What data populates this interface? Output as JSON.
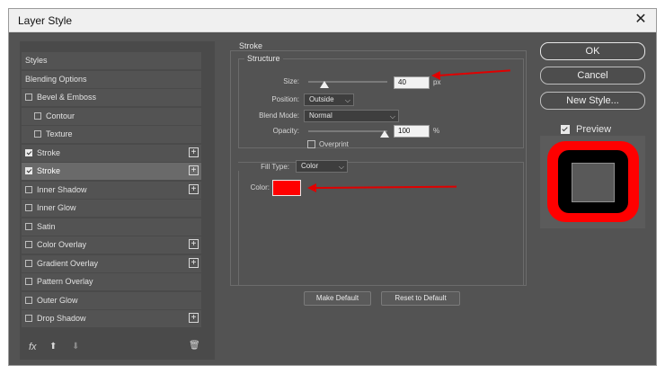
{
  "window": {
    "title": "Layer Style",
    "close_glyph": "✕"
  },
  "left_panel": {
    "items": [
      {
        "label": "Styles",
        "checkbox": false,
        "checked": false,
        "plus": false,
        "selected": false,
        "indent": 0
      },
      {
        "label": "Blending Options",
        "checkbox": false,
        "checked": false,
        "plus": false,
        "selected": false,
        "indent": 0
      },
      {
        "label": "Bevel & Emboss",
        "checkbox": true,
        "checked": false,
        "plus": false,
        "selected": false,
        "indent": 0
      },
      {
        "label": "Contour",
        "checkbox": true,
        "checked": false,
        "plus": false,
        "selected": false,
        "indent": 1
      },
      {
        "label": "Texture",
        "checkbox": true,
        "checked": false,
        "plus": false,
        "selected": false,
        "indent": 1
      },
      {
        "label": "Stroke",
        "checkbox": true,
        "checked": true,
        "plus": true,
        "selected": false,
        "indent": 0
      },
      {
        "label": "Stroke",
        "checkbox": true,
        "checked": true,
        "plus": true,
        "selected": true,
        "indent": 0
      },
      {
        "label": "Inner Shadow",
        "checkbox": true,
        "checked": false,
        "plus": true,
        "selected": false,
        "indent": 0
      },
      {
        "label": "Inner Glow",
        "checkbox": true,
        "checked": false,
        "plus": false,
        "selected": false,
        "indent": 0
      },
      {
        "label": "Satin",
        "checkbox": true,
        "checked": false,
        "plus": false,
        "selected": false,
        "indent": 0
      },
      {
        "label": "Color Overlay",
        "checkbox": true,
        "checked": false,
        "plus": true,
        "selected": false,
        "indent": 0
      },
      {
        "label": "Gradient Overlay",
        "checkbox": true,
        "checked": false,
        "plus": true,
        "selected": false,
        "indent": 0
      },
      {
        "label": "Pattern Overlay",
        "checkbox": true,
        "checked": false,
        "plus": false,
        "selected": false,
        "indent": 0
      },
      {
        "label": "Outer Glow",
        "checkbox": true,
        "checked": false,
        "plus": false,
        "selected": false,
        "indent": 0
      },
      {
        "label": "Drop Shadow",
        "checkbox": true,
        "checked": false,
        "plus": true,
        "selected": false,
        "indent": 0
      }
    ],
    "plus_glyph": "+",
    "bottom_icons": {
      "fx": "fx",
      "up": "⬆",
      "down": "⬇",
      "trash": "🗑"
    }
  },
  "stroke": {
    "heading": "Stroke",
    "structure_heading": "Structure",
    "size_label": "Size:",
    "size_value": "40",
    "size_unit": "px",
    "size_level": 0.2,
    "position_label": "Position:",
    "position_value": "Outside",
    "blend_label": "Blend Mode:",
    "blend_value": "Normal",
    "opacity_label": "Opacity:",
    "opacity_value": "100",
    "opacity_unit": "%",
    "opacity_level": 1.0,
    "overprint_label": "Overprint",
    "fill_type_label": "Fill Type:",
    "fill_type_value": "Color",
    "color_label": "Color:",
    "color_value": "#ff0000",
    "make_default_label": "Make Default",
    "reset_default_label": "Reset to Default"
  },
  "buttons": {
    "ok": "OK",
    "cancel": "Cancel",
    "new_style": "New Style..."
  },
  "preview": {
    "label": "Preview",
    "checked": true
  },
  "colors": {
    "dialog_bg": "#535353",
    "stroke_color": "#ff0000",
    "arrow": "#e00000"
  }
}
